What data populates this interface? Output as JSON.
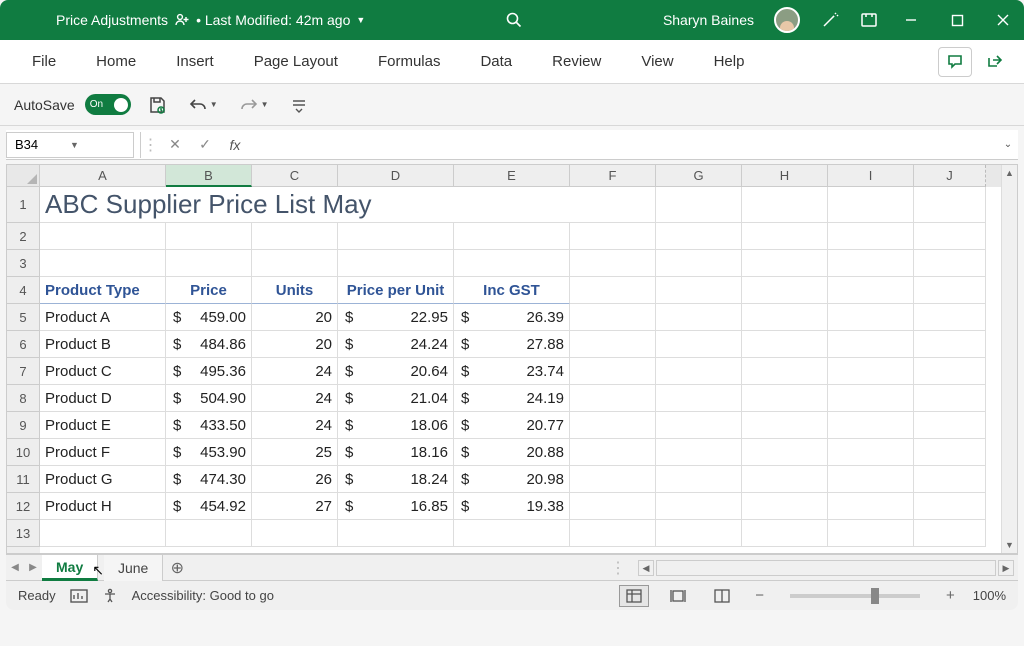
{
  "title_bar": {
    "doc_name": "Price Adjustments",
    "last_modified": "• Last Modified: 42m ago",
    "user_name": "Sharyn Baines"
  },
  "ribbon": {
    "tabs": [
      "File",
      "Home",
      "Insert",
      "Page Layout",
      "Formulas",
      "Data",
      "Review",
      "View",
      "Help"
    ]
  },
  "toolbar": {
    "autosave": "AutoSave",
    "toggle": "On"
  },
  "formula_bar": {
    "name_box": "B34",
    "fx": "fx",
    "formula": ""
  },
  "columns": [
    "A",
    "B",
    "C",
    "D",
    "E",
    "F",
    "G",
    "H",
    "I",
    "J"
  ],
  "row_labels": [
    "1",
    "2",
    "3",
    "4",
    "5",
    "6",
    "7",
    "8",
    "9",
    "10",
    "11",
    "12",
    "13"
  ],
  "sheet": {
    "title": "ABC Supplier Price List May",
    "headers": [
      "Product Type",
      "Price",
      "Units",
      "Price per Unit",
      "Inc GST"
    ],
    "rows": [
      {
        "p": "Product A",
        "price": "459.00",
        "u": "20",
        "ppu": "22.95",
        "gst": "26.39"
      },
      {
        "p": "Product B",
        "price": "484.86",
        "u": "20",
        "ppu": "24.24",
        "gst": "27.88"
      },
      {
        "p": "Product C",
        "price": "495.36",
        "u": "24",
        "ppu": "20.64",
        "gst": "23.74"
      },
      {
        "p": "Product D",
        "price": "504.90",
        "u": "24",
        "ppu": "21.04",
        "gst": "24.19"
      },
      {
        "p": "Product E",
        "price": "433.50",
        "u": "24",
        "ppu": "18.06",
        "gst": "20.77"
      },
      {
        "p": "Product F",
        "price": "453.90",
        "u": "25",
        "ppu": "18.16",
        "gst": "20.88"
      },
      {
        "p": "Product G",
        "price": "474.30",
        "u": "26",
        "ppu": "18.24",
        "gst": "20.98"
      },
      {
        "p": "Product H",
        "price": "454.92",
        "u": "27",
        "ppu": "16.85",
        "gst": "19.38"
      }
    ]
  },
  "sheet_tabs": [
    "May",
    "June"
  ],
  "status_bar": {
    "ready": "Ready",
    "accessibility": "Accessibility: Good to go",
    "zoom": "100%"
  },
  "selected_col": "B"
}
